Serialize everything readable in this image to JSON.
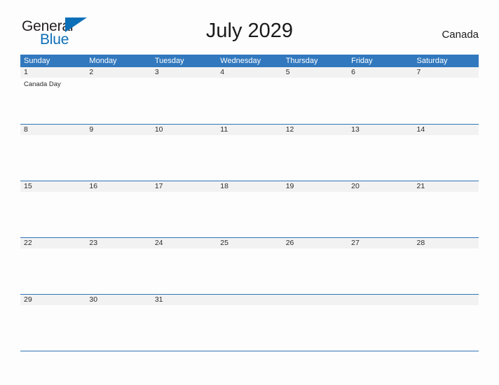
{
  "brand": {
    "name_part1": "General",
    "name_part2": "Blue",
    "flag_icon": "blue-triangle-flag-icon",
    "logo_color": "#0d6fb8"
  },
  "header": {
    "title": "July 2029",
    "region": "Canada"
  },
  "theme": {
    "header_blue": "#3178be",
    "grid_line_blue": "#2e75b6",
    "day_strip_gray": "#f2f2f2",
    "page_background": "#fdfdfe"
  },
  "calendar": {
    "month": "July",
    "year": "2029",
    "weekday_headers": [
      "Sunday",
      "Monday",
      "Tuesday",
      "Wednesday",
      "Thursday",
      "Friday",
      "Saturday"
    ],
    "weeks": [
      {
        "days": [
          {
            "number": "1",
            "events": [
              "Canada Day"
            ]
          },
          {
            "number": "2",
            "events": []
          },
          {
            "number": "3",
            "events": []
          },
          {
            "number": "4",
            "events": []
          },
          {
            "number": "5",
            "events": []
          },
          {
            "number": "6",
            "events": []
          },
          {
            "number": "7",
            "events": []
          }
        ]
      },
      {
        "days": [
          {
            "number": "8",
            "events": []
          },
          {
            "number": "9",
            "events": []
          },
          {
            "number": "10",
            "events": []
          },
          {
            "number": "11",
            "events": []
          },
          {
            "number": "12",
            "events": []
          },
          {
            "number": "13",
            "events": []
          },
          {
            "number": "14",
            "events": []
          }
        ]
      },
      {
        "days": [
          {
            "number": "15",
            "events": []
          },
          {
            "number": "16",
            "events": []
          },
          {
            "number": "17",
            "events": []
          },
          {
            "number": "18",
            "events": []
          },
          {
            "number": "19",
            "events": []
          },
          {
            "number": "20",
            "events": []
          },
          {
            "number": "21",
            "events": []
          }
        ]
      },
      {
        "days": [
          {
            "number": "22",
            "events": []
          },
          {
            "number": "23",
            "events": []
          },
          {
            "number": "24",
            "events": []
          },
          {
            "number": "25",
            "events": []
          },
          {
            "number": "26",
            "events": []
          },
          {
            "number": "27",
            "events": []
          },
          {
            "number": "28",
            "events": []
          }
        ]
      },
      {
        "days": [
          {
            "number": "29",
            "events": []
          },
          {
            "number": "30",
            "events": []
          },
          {
            "number": "31",
            "events": []
          },
          {
            "number": "",
            "events": []
          },
          {
            "number": "",
            "events": []
          },
          {
            "number": "",
            "events": []
          },
          {
            "number": "",
            "events": []
          }
        ]
      }
    ]
  }
}
